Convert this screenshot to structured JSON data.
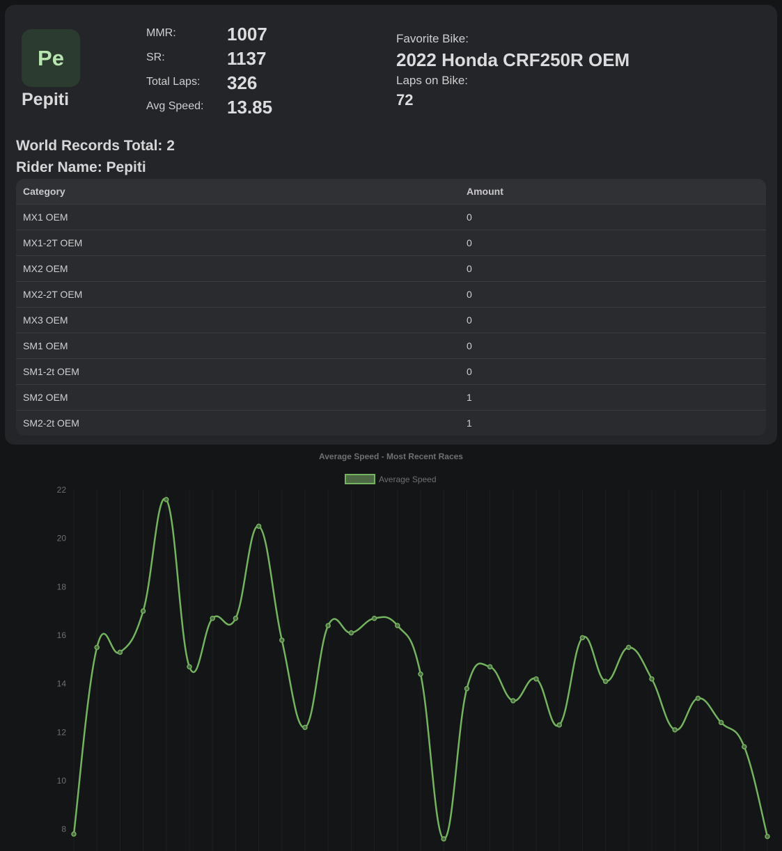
{
  "profile": {
    "avatar_initials": "Pe",
    "rider_display": "Pepiti",
    "stats": [
      {
        "label": "MMR:",
        "value": "1007"
      },
      {
        "label": "SR:",
        "value": "1137"
      },
      {
        "label": "Total Laps:",
        "value": "326"
      },
      {
        "label": "Avg Speed:",
        "value": "13.85"
      }
    ],
    "favorite_bike_label": "Favorite Bike:",
    "favorite_bike": "2022 Honda CRF250R OEM",
    "laps_on_bike_label": "Laps on Bike:",
    "laps_on_bike": "72"
  },
  "records": {
    "total_text": "World Records Total: 2",
    "rider_text": "Rider Name: Pepiti",
    "headers": {
      "category": "Category",
      "amount": "Amount"
    },
    "rows": [
      {
        "category": "MX1 OEM",
        "amount": "0"
      },
      {
        "category": "MX1-2T OEM",
        "amount": "0"
      },
      {
        "category": "MX2 OEM",
        "amount": "0"
      },
      {
        "category": "MX2-2T OEM",
        "amount": "0"
      },
      {
        "category": "MX3 OEM",
        "amount": "0"
      },
      {
        "category": "SM1 OEM",
        "amount": "0"
      },
      {
        "category": "SM1-2t OEM",
        "amount": "0"
      },
      {
        "category": "SM2 OEM",
        "amount": "1"
      },
      {
        "category": "SM2-2t OEM",
        "amount": "1"
      }
    ]
  },
  "colors": {
    "line": "#74b35f",
    "grid": "#1f2022",
    "card_bg": "#242528",
    "page_bg": "#141516"
  },
  "chart_data": {
    "type": "line",
    "title": "Average Speed - Most Recent Races",
    "legend_placement": "top",
    "series": [
      {
        "name": "Average Speed",
        "values": [
          7.8,
          15.5,
          15.3,
          17.0,
          21.6,
          14.7,
          16.7,
          16.7,
          20.5,
          15.8,
          12.2,
          16.4,
          16.1,
          16.7,
          16.4,
          14.4,
          7.6,
          13.8,
          14.7,
          13.3,
          14.2,
          12.3,
          15.9,
          14.1,
          15.5,
          14.2,
          12.1,
          13.4,
          12.4,
          11.4,
          7.7
        ]
      }
    ],
    "y_ticks": [
      8,
      10,
      12,
      14,
      16,
      18,
      20,
      22
    ],
    "ylim": [
      7.1,
      22
    ],
    "xlabel": "",
    "ylabel": "",
    "grid": true
  }
}
